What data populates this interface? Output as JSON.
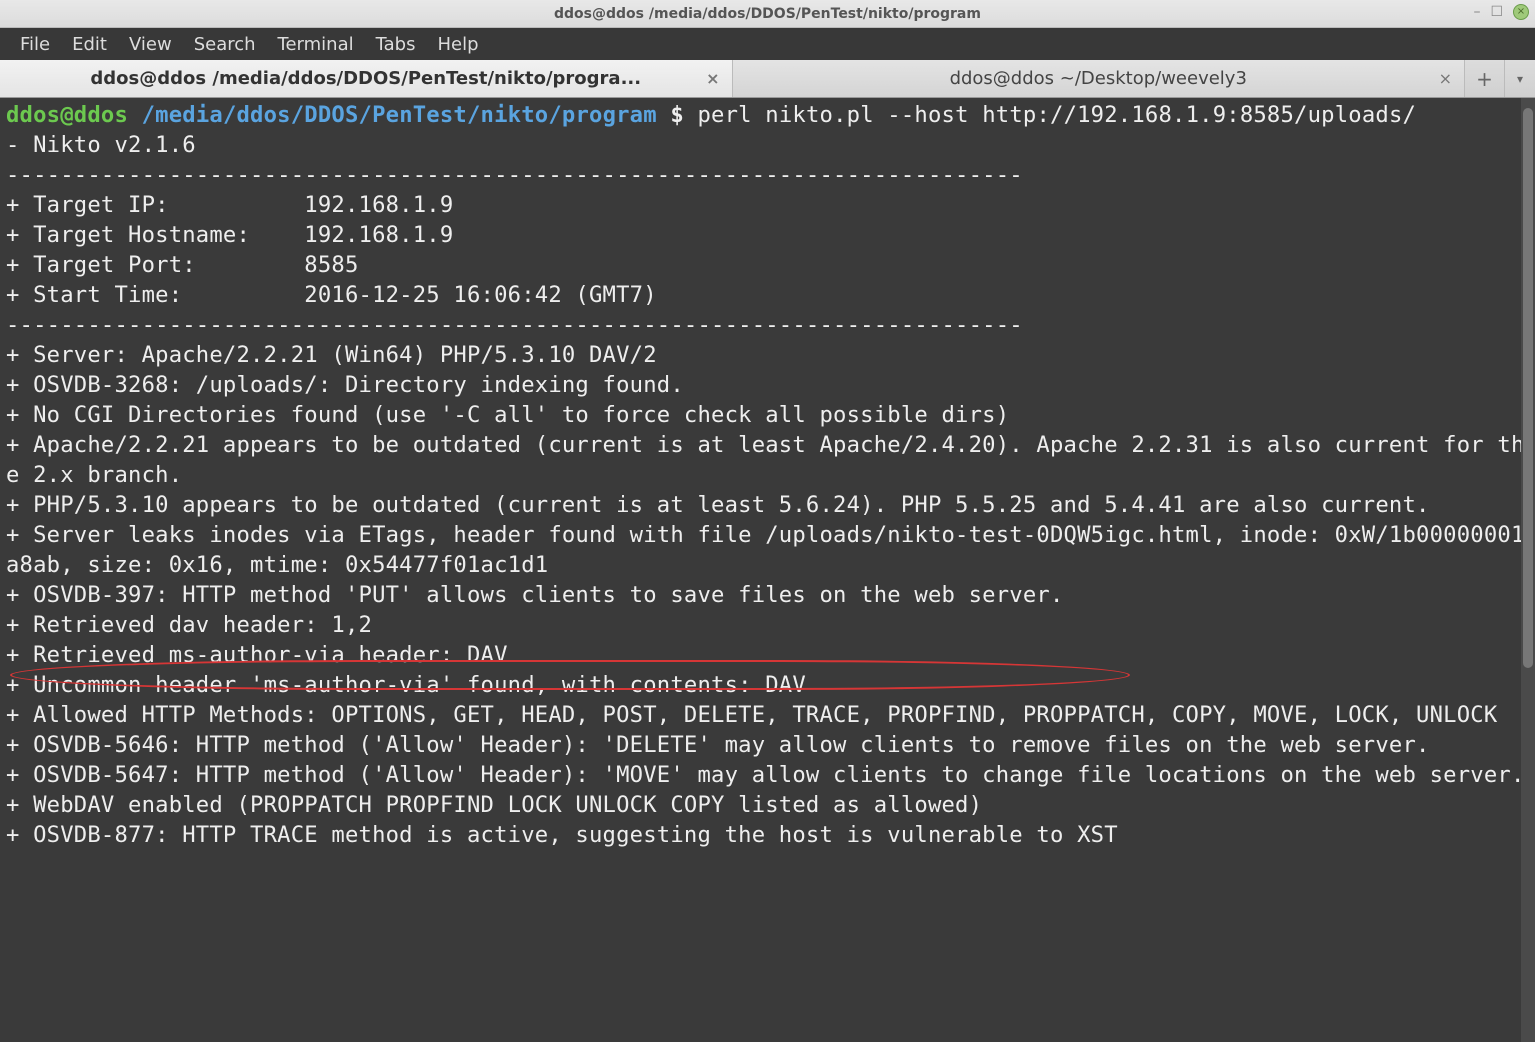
{
  "window": {
    "title": "ddos@ddos /media/ddos/DDOS/PenTest/nikto/program"
  },
  "menu": {
    "file": "File",
    "edit": "Edit",
    "view": "View",
    "search": "Search",
    "terminal": "Terminal",
    "tabs": "Tabs",
    "help": "Help"
  },
  "tabs": [
    {
      "label": "ddos@ddos /media/ddos/DDOS/PenTest/nikto/progra...",
      "active": true
    },
    {
      "label": "ddos@ddos ~/Desktop/weevely3",
      "active": false
    }
  ],
  "prompt": {
    "user_host": "ddos@ddos",
    "path": "/media/ddos/DDOS/PenTest/nikto/program",
    "symbol": "$",
    "command": "perl nikto.pl --host http://192.168.1.9:8585/uploads/"
  },
  "output": {
    "l0": "- Nikto v2.1.6",
    "dash_line": "---------------------------------------------------------------------------",
    "l1": "+ Target IP:          192.168.1.9",
    "l2": "+ Target Hostname:    192.168.1.9",
    "l3": "+ Target Port:        8585",
    "l4": "+ Start Time:         2016-12-25 16:06:42 (GMT7)",
    "l5": "+ Server: Apache/2.2.21 (Win64) PHP/5.3.10 DAV/2",
    "l6": "+ OSVDB-3268: /uploads/: Directory indexing found.",
    "l7": "+ No CGI Directories found (use '-C all' to force check all possible dirs)",
    "l8": "+ Apache/2.2.21 appears to be outdated (current is at least Apache/2.4.20). Apache 2.2.31 is also current for the 2.x branch.",
    "l9": "+ PHP/5.3.10 appears to be outdated (current is at least 5.6.24). PHP 5.5.25 and 5.4.41 are also current.",
    "l10": "+ Server leaks inodes via ETags, header found with file /uploads/nikto-test-0DQW5igc.html, inode: 0xW/1b00000001a8ab, size: 0x16, mtime: 0x54477f01ac1d1",
    "l11": "+ OSVDB-397: HTTP method 'PUT' allows clients to save files on the web server.",
    "l12": "+ Retrieved dav header: 1,2",
    "l13": "+ Retrieved ms-author-via header: DAV",
    "l14": "+ Uncommon header 'ms-author-via' found, with contents: DAV",
    "l15": "+ Allowed HTTP Methods: OPTIONS, GET, HEAD, POST, DELETE, TRACE, PROPFIND, PROPPATCH, COPY, MOVE, LOCK, UNLOCK ",
    "l16": "+ OSVDB-5646: HTTP method ('Allow' Header): 'DELETE' may allow clients to remove files on the web server.",
    "l17": "+ OSVDB-5647: HTTP method ('Allow' Header): 'MOVE' may allow clients to change file locations on the web server.",
    "l18": "+ WebDAV enabled (PROPPATCH PROPFIND LOCK UNLOCK COPY listed as allowed)",
    "l19": "+ OSVDB-877: HTTP TRACE method is active, suggesting the host is vulnerable to XST"
  }
}
